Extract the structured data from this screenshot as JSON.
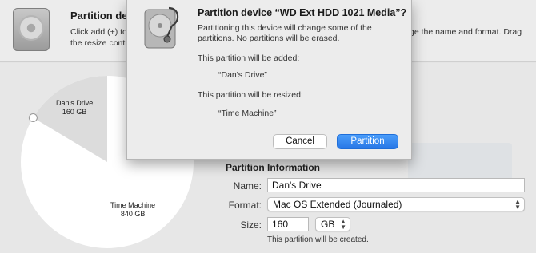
{
  "background_window": {
    "title": "Partition devi",
    "description_left": [
      "Click add (+) to",
      "the resize contr"
    ],
    "description_right": "ge the name and format. Drag"
  },
  "pie": {
    "slices": [
      {
        "name": "Dan's Drive",
        "size": "160 GB",
        "fraction": 0.16,
        "color": "#dcdcdc"
      },
      {
        "name": "Time Machine",
        "size": "840 GB",
        "fraction": 0.84,
        "color": "#ffffff"
      }
    ]
  },
  "partition_info": {
    "title": "Partition Information",
    "name_label": "Name:",
    "name_value": "Dan's Drive",
    "format_label": "Format:",
    "format_value": "Mac OS Extended (Journaled)",
    "size_label": "Size:",
    "size_value": "160",
    "size_unit": "GB",
    "note": "This partition will be created."
  },
  "sheet": {
    "title": "Partition device “WD Ext HDD 1021 Media”?",
    "description": [
      "Partitioning this device will change some of the",
      "partitions. No partitions will be erased."
    ],
    "added_heading": "This partition will be added:",
    "added_item": "“Dan's Drive”",
    "resized_heading": "This partition will be resized:",
    "resized_item": "“Time Machine”",
    "cancel_label": "Cancel",
    "partition_label": "Partition"
  },
  "colors": {
    "accent": "#2f80ed",
    "sheet_bg": "#ececec"
  },
  "icons": [
    "disk-utility-icon",
    "hard-drive-icon",
    "stepper-arrows-icon"
  ]
}
